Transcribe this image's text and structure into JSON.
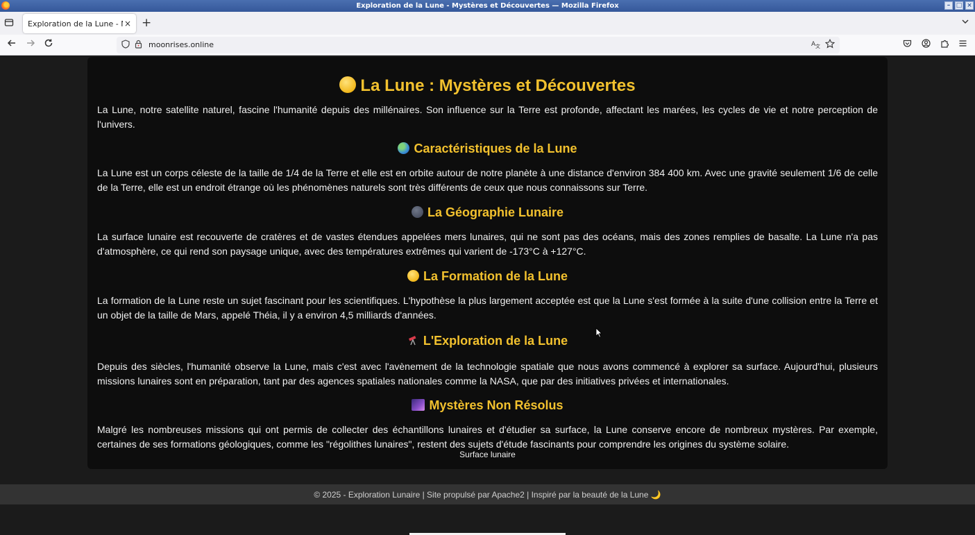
{
  "window": {
    "title": "Exploration de la Lune - Mystères et Découvertes — Mozilla Firefox"
  },
  "tabs": {
    "active_title": "Exploration de la Lune - Mystères et Découvertes",
    "close_glyph": "×",
    "new_tab_glyph": "+"
  },
  "navbar": {
    "url": "moonrises.online"
  },
  "page": {
    "title_emoji": "🌕",
    "title": "La Lune : Mystères et Découvertes",
    "intro": "La Lune, notre satellite naturel, fascine l'humanité depuis des millénaires. Son influence sur la Terre est profonde, affectant les marées, les cycles de vie et notre perception de l'univers.",
    "sections": [
      {
        "emoji": "🌍",
        "heading": "Caractéristiques de la Lune",
        "text": "La Lune est un corps céleste de la taille de 1/4 de la Terre et elle est en orbite autour de notre planète à une distance d'environ 384 400 km. Avec une gravité seulement 1/6 de celle de la Terre, elle est un endroit étrange où les phénomènes naturels sont très différents de ceux que nous connaissons sur Terre."
      },
      {
        "emoji": "🌑",
        "heading": "La Géographie Lunaire",
        "text": "La surface lunaire est recouverte de cratères et de vastes étendues appelées mers lunaires, qui ne sont pas des océans, mais des zones remplies de basalte. La Lune n'a pas d'atmosphère, ce qui rend son paysage unique, avec des températures extrêmes qui varient de -173°C à +127°C."
      },
      {
        "emoji": "🌕",
        "heading": "La Formation de la Lune",
        "text": "La formation de la Lune reste un sujet fascinant pour les scientifiques. L'hypothèse la plus largement acceptée est que la Lune s'est formée à la suite d'une collision entre la Terre et un objet de la taille de Mars, appelé Théia, il y a environ 4,5 milliards d'années."
      },
      {
        "emoji": "🔭",
        "heading": "L'Exploration de la Lune",
        "text": "Depuis des siècles, l'humanité observe la Lune, mais c'est avec l'avènement de la technologie spatiale que nous avons commencé à explorer sa surface. Aujourd'hui, plusieurs missions lunaires sont en préparation, tant par des agences spatiales nationales comme la NASA, que par des initiatives privées et internationales."
      },
      {
        "emoji": "🌌",
        "heading": "Mystères Non Résolus",
        "text": "Malgré les nombreuses missions qui ont permis de collecter des échantillons lunaires et d'étudier sa surface, la Lune conserve encore de nombreux mystères. Par exemple, certaines de ses formations géologiques, comme les \"régolithes lunaires\", restent des sujets d'étude fascinants pour comprendre les origines du système solaire."
      }
    ],
    "image_alt": "Surface lunaire",
    "footer": "© 2025 - Exploration Lunaire | Site propulsé par Apache2 | Inspiré par la beauté de la Lune 🌙"
  }
}
